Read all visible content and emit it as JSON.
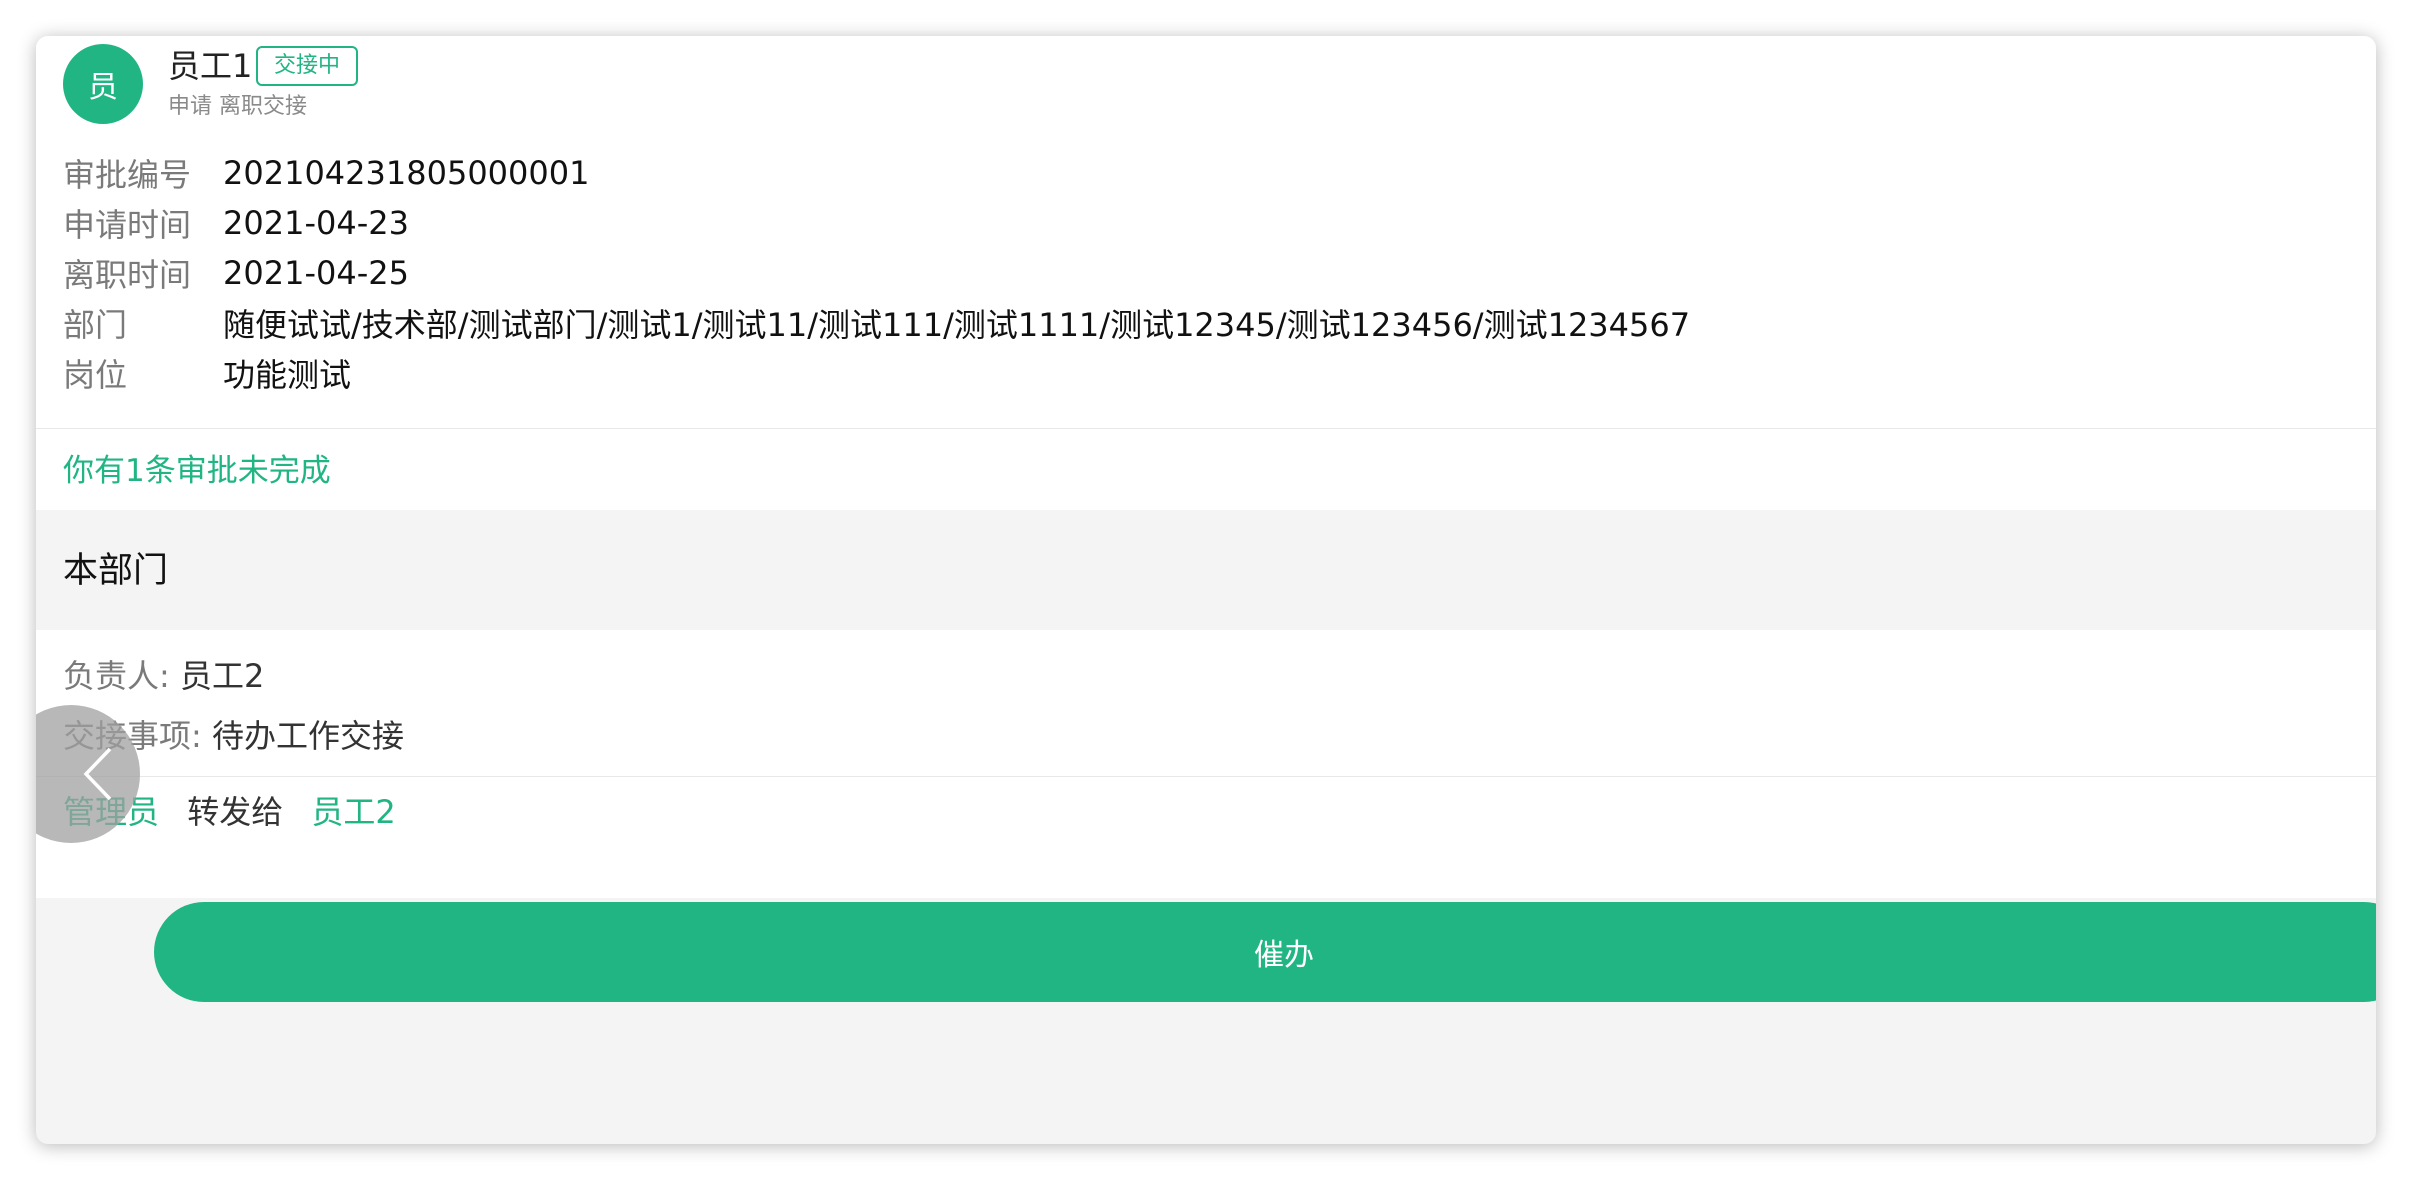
{
  "colors": {
    "accent": "#21b584"
  },
  "header": {
    "avatar_text": "员",
    "name": "员工1",
    "status_badge": "交接中",
    "subtitle": "申请 离职交接"
  },
  "info": [
    {
      "label": "审批编号",
      "value": "202104231805000001"
    },
    {
      "label": "申请时间",
      "value": "2021-04-23"
    },
    {
      "label": "离职时间",
      "value": "2021-04-25"
    },
    {
      "label": "部门",
      "value": "随便试试/技术部/测试部门/测试1/测试11/测试111/测试1111/测试12345/测试123456/测试1234567"
    },
    {
      "label": "岗位",
      "value": "功能测试"
    }
  ],
  "pending_notice": "你有1条审批未完成",
  "section": {
    "title": "本部门",
    "owner_label": "负责人:",
    "owner_value": "员工2",
    "handover_label": "交接事项:",
    "handover_value": "待办工作交接",
    "flow_from": "管理员",
    "flow_action": "转发给",
    "flow_to": "员工2"
  },
  "actions": {
    "urge_label": "催办"
  },
  "icons": {
    "back": "chevron-left-icon"
  }
}
